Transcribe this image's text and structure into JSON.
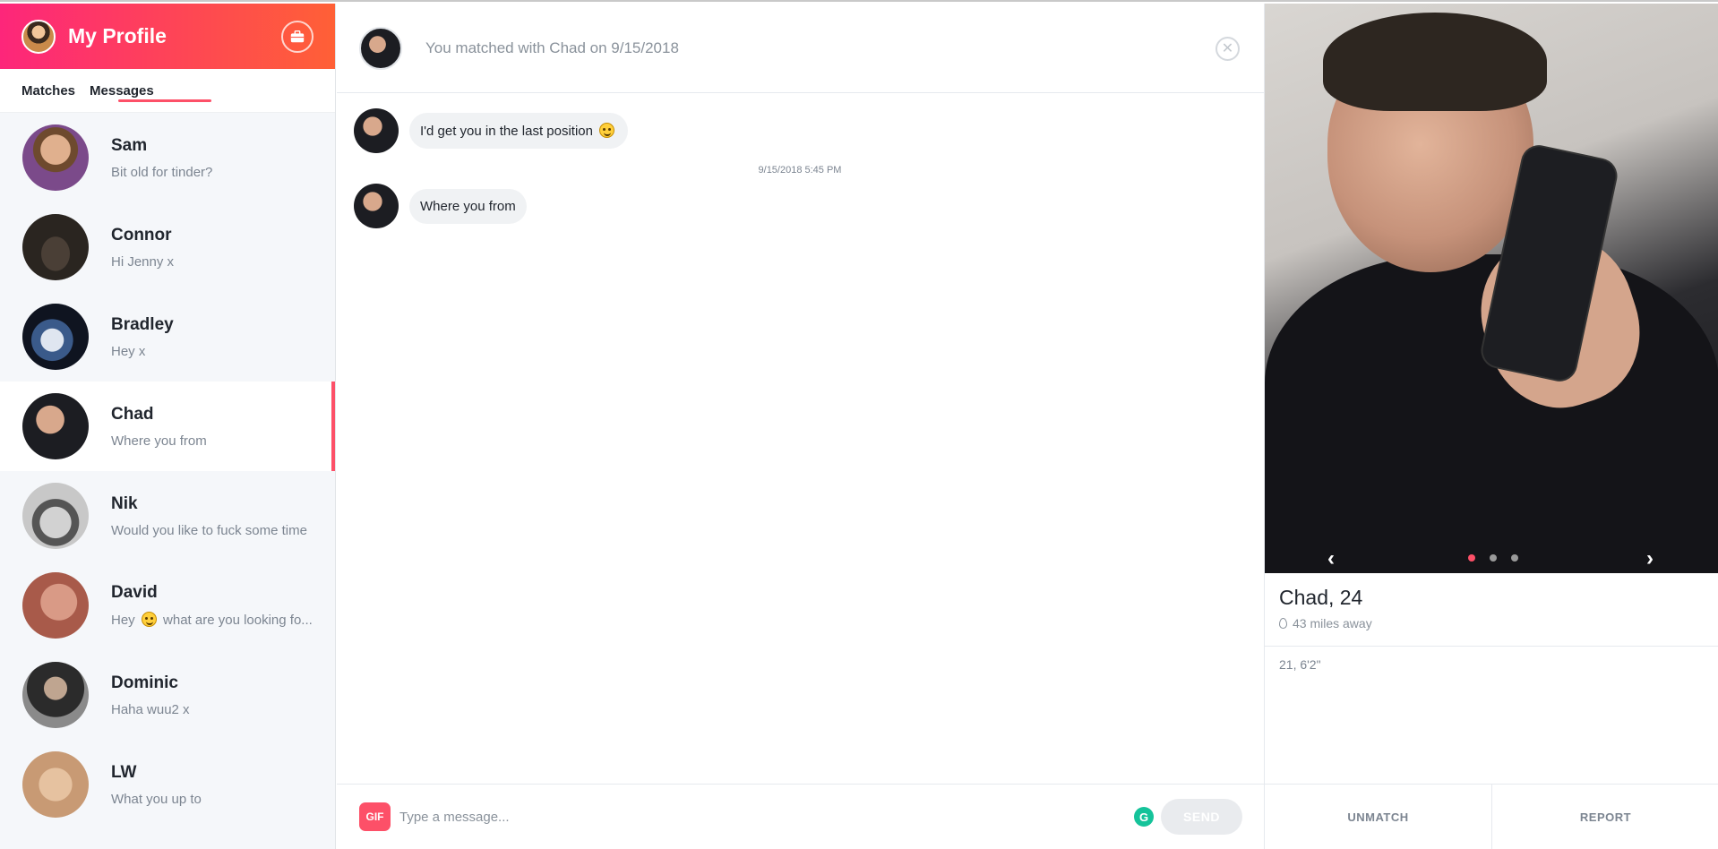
{
  "sidebar": {
    "title": "My Profile",
    "tabs": [
      {
        "label": "Matches"
      },
      {
        "label": "Messages"
      }
    ],
    "matches": [
      {
        "name": "Sam",
        "preview": "Bit old for tinder?",
        "avatar_color": "#7b4a8a"
      },
      {
        "name": "Connor",
        "preview": "Hi Jenny x",
        "avatar_color": "#3b3530"
      },
      {
        "name": "Bradley",
        "preview": "Hey x",
        "avatar_color": "#223047"
      },
      {
        "name": "Chad",
        "preview": "Where you from",
        "avatar_color": "#1c1d22"
      },
      {
        "name": "Nik",
        "preview": "Would you like to fuck some time",
        "avatar_color": "#9a9a9a"
      },
      {
        "name": "David",
        "preview_before": "Hey",
        "preview_after": "what are you looking fo...",
        "avatar_color": "#a85a4a"
      },
      {
        "name": "Dominic",
        "preview": "Haha wuu2 x",
        "avatar_color": "#4a4a4a"
      },
      {
        "name": "LW",
        "preview": "What you up to",
        "avatar_color": "#c89a74"
      }
    ]
  },
  "chat": {
    "header": "You matched with Chad on 9/15/2018",
    "messages": [
      {
        "text": "I'd get you in the last position"
      },
      {
        "text": "Where you from"
      }
    ],
    "timestamp": "9/15/2018 5:45 PM",
    "composer": {
      "gif_label": "GIF",
      "placeholder": "Type a message...",
      "grammarly_label": "G",
      "send_label": "SEND"
    }
  },
  "profile": {
    "name": "Chad, 24",
    "distance": "43 miles away",
    "bio": "21, 6'2\"",
    "photo_count": 3,
    "active_photo": 1,
    "unmatch_label": "UNMATCH",
    "report_label": "REPORT"
  },
  "colors": {
    "brand_gradient_start": "#fd267a",
    "brand_gradient_end": "#ff6036",
    "accent": "#fd5068"
  }
}
